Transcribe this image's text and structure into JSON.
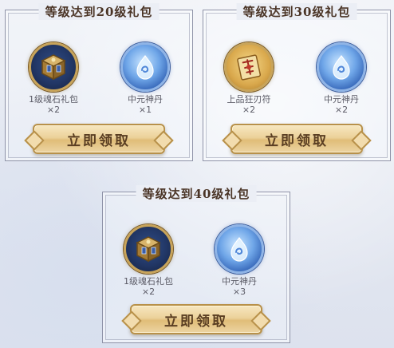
{
  "packs": [
    {
      "title": "等级达到20级礼包",
      "button_label": "立即领取",
      "items": [
        {
          "name": "1级魂石礼包",
          "qty": "×2",
          "icon": "soul-stone-box-icon"
        },
        {
          "name": "中元神丹",
          "qty": "×1",
          "icon": "spirit-pill-icon"
        }
      ]
    },
    {
      "title": "等级达到30级礼包",
      "button_label": "立即领取",
      "items": [
        {
          "name": "上品狂刃符",
          "qty": "×2",
          "icon": "blade-talisman-icon"
        },
        {
          "name": "中元神丹",
          "qty": "×2",
          "icon": "spirit-pill-icon"
        }
      ]
    },
    {
      "title": "等级达到40级礼包",
      "button_label": "立即领取",
      "items": [
        {
          "name": "1级魂石礼包",
          "qty": "×2",
          "icon": "soul-stone-box-icon"
        },
        {
          "name": "中元神丹",
          "qty": "×3",
          "icon": "spirit-pill-icon"
        }
      ]
    }
  ],
  "colors": {
    "title_text": "#4a3426",
    "button_gold": "#ecd29a",
    "button_border": "#b8914a",
    "panel_border": "#8f93a8"
  }
}
